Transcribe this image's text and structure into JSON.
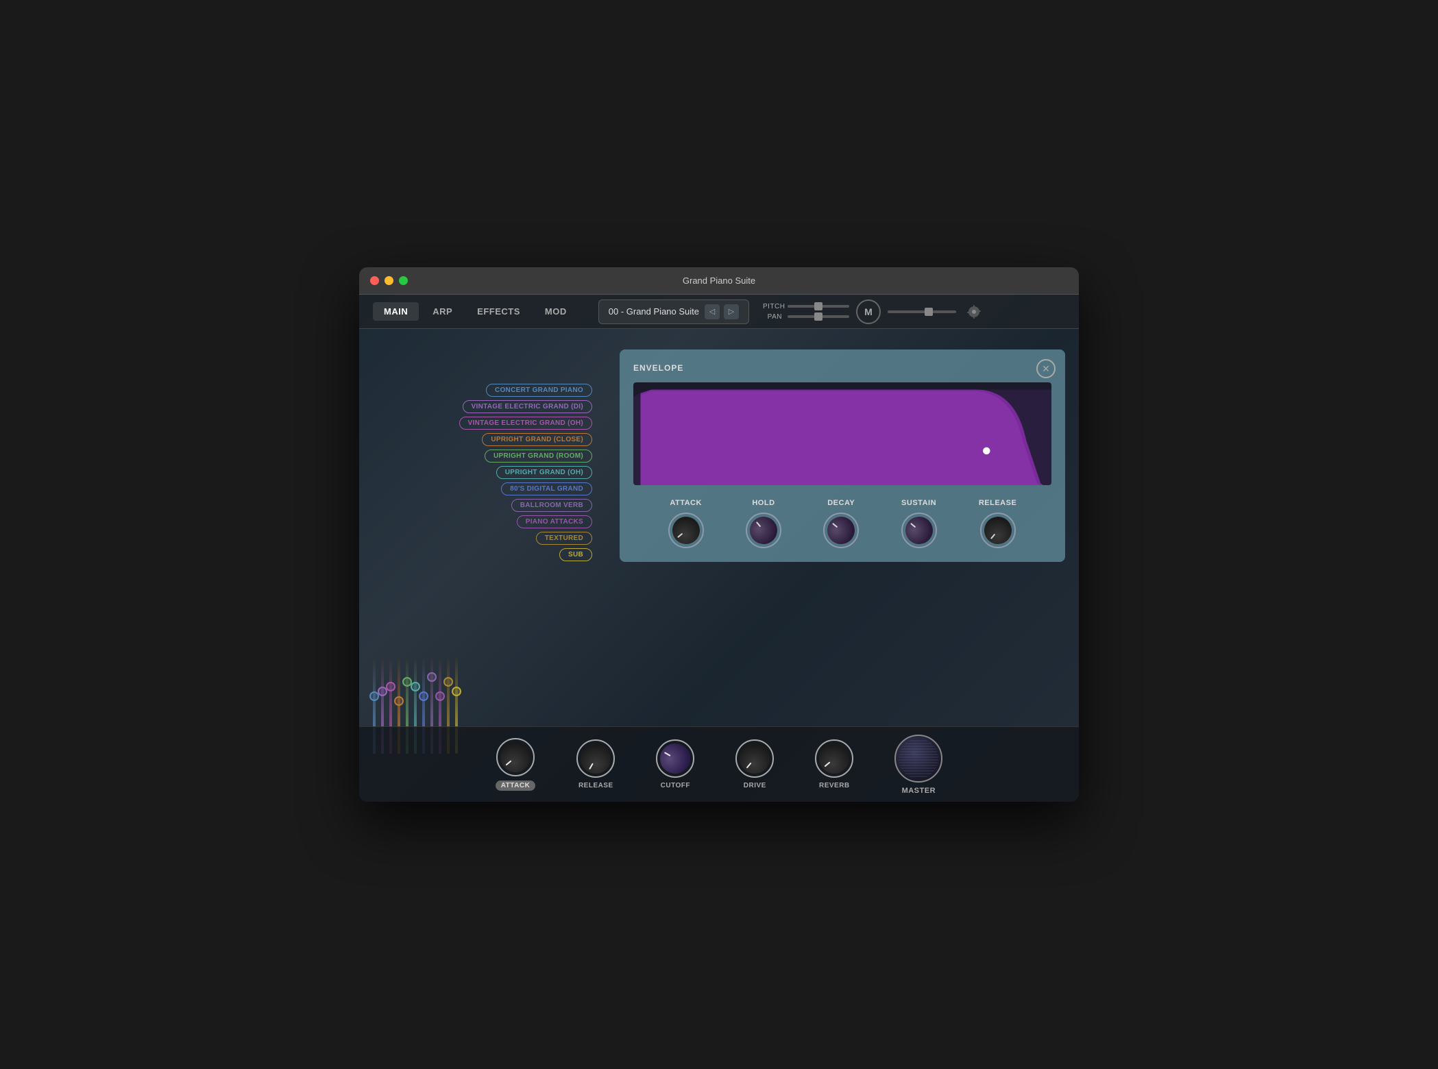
{
  "window": {
    "title": "Grand Piano Suite"
  },
  "nav": {
    "tabs": [
      {
        "label": "MAIN",
        "active": true
      },
      {
        "label": "ARP",
        "active": false
      },
      {
        "label": "EFFECTS",
        "active": false
      },
      {
        "label": "MOD",
        "active": false
      }
    ],
    "preset": "00 - Grand Piano Suite",
    "pitch_label": "PITCH",
    "pan_label": "PAN",
    "m_label": "M"
  },
  "instruments": [
    {
      "label": "CONCERT GRAND PIANO",
      "color": "#5588bb"
    },
    {
      "label": "VINTAGE ELECTRIC GRAND (DI)",
      "color": "#9966bb"
    },
    {
      "label": "VINTAGE ELECTRIC GRAND (OH)",
      "color": "#aa55aa"
    },
    {
      "label": "UPRIGHT GRAND (CLOSE)",
      "color": "#bb7733"
    },
    {
      "label": "UPRIGHT GRAND (ROOM)",
      "color": "#66aa66"
    },
    {
      "label": "UPRIGHT GRAND (OH)",
      "color": "#55aaaa"
    },
    {
      "label": "80'S DIGITAL GRAND",
      "color": "#5577cc"
    },
    {
      "label": "BALLROOM VERB",
      "color": "#8866aa"
    },
    {
      "label": "PIANO ATTACKS",
      "color": "#9955aa"
    },
    {
      "label": "TEXTURED",
      "color": "#aa8833"
    },
    {
      "label": "SUB",
      "color": "#bbaa33"
    }
  ],
  "envelope": {
    "title": "ENVELOPE",
    "close_symbol": "✕",
    "params": [
      {
        "label": "ATTACK",
        "rotation": -130
      },
      {
        "label": "HOLD",
        "rotation": -40
      },
      {
        "label": "DECAY",
        "rotation": -50
      },
      {
        "label": "SUSTAIN",
        "rotation": -50
      },
      {
        "label": "RELEASE",
        "rotation": -140
      }
    ]
  },
  "bottom_knobs": [
    {
      "label": "ATTACK",
      "active": true,
      "rotation": -130
    },
    {
      "label": "RELEASE",
      "active": false,
      "rotation": -150
    },
    {
      "label": "CUTOFF",
      "active": false,
      "rotation": -60
    },
    {
      "label": "DRIVE",
      "active": false,
      "rotation": -140
    },
    {
      "label": "REVERB",
      "active": false,
      "rotation": -130
    }
  ],
  "master": {
    "label": "MASTER"
  },
  "faders": [
    {
      "color": "#5588bb",
      "position": 55
    },
    {
      "color": "#9966bb",
      "position": 60
    },
    {
      "color": "#aa55aa",
      "position": 65
    },
    {
      "color": "#bb7733",
      "position": 50
    },
    {
      "color": "#66aa66",
      "position": 70
    },
    {
      "color": "#55aaaa",
      "position": 65
    },
    {
      "color": "#5577cc",
      "position": 55
    },
    {
      "color": "#8866aa",
      "position": 75
    },
    {
      "color": "#9955aa",
      "position": 55
    },
    {
      "color": "#aa8833",
      "position": 70
    },
    {
      "color": "#bbaa33",
      "position": 60
    }
  ]
}
